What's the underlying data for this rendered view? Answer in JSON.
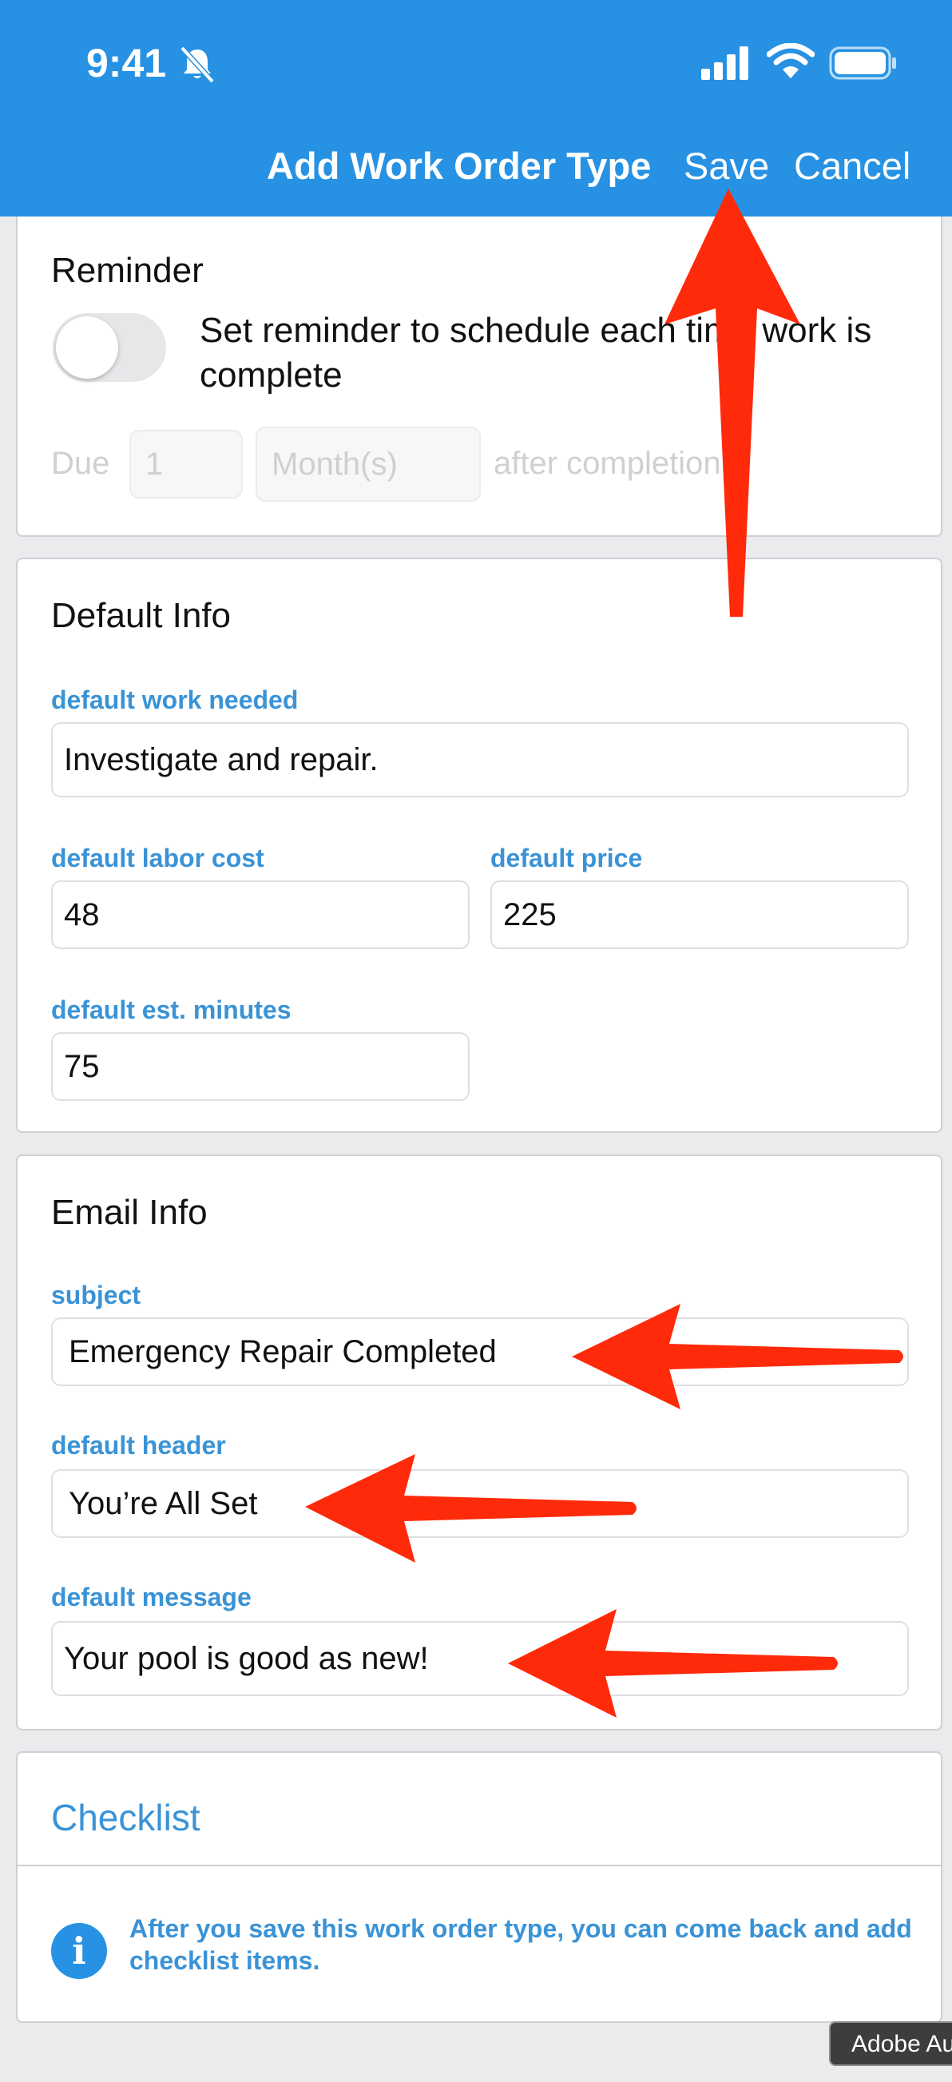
{
  "status_bar": {
    "time": "9:41"
  },
  "header": {
    "title": "Add Work Order Type",
    "save_label": "Save",
    "cancel_label": "Cancel"
  },
  "reminder": {
    "title": "Reminder",
    "toggle_on": false,
    "text": "Set reminder to schedule each time work is complete",
    "due_label": "Due",
    "due_value": "1",
    "unit_value": "Month(s)",
    "after_label": "after completion"
  },
  "default_info": {
    "title": "Default Info",
    "work_needed": {
      "label": "default work needed",
      "value": "Investigate and repair."
    },
    "labor_cost": {
      "label": "default labor cost",
      "value": "48"
    },
    "price": {
      "label": "default price",
      "value": "225"
    },
    "est_minutes": {
      "label": "default est. minutes",
      "value": "75"
    }
  },
  "email_info": {
    "title": "Email Info",
    "subject": {
      "label": "subject",
      "value": "Emergency Repair Completed"
    },
    "header": {
      "label": "default header",
      "value": "You’re All Set"
    },
    "message": {
      "label": "default message",
      "value": "Your pool is good as new!"
    }
  },
  "checklist": {
    "title": "Checklist",
    "info_text": "After you save this work order type, you can come back and add checklist items."
  },
  "overlay": {
    "tag_text": "Adobe Au"
  },
  "colors": {
    "header_bg": "#2792e4",
    "accent": "#3a93d6",
    "annotation_arrow": "#ff2a0a"
  }
}
